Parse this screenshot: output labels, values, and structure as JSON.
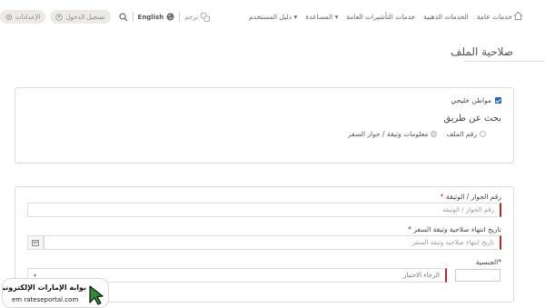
{
  "header": {
    "nav": [
      "خدمات عامة",
      "الخدمات الذهبية",
      "خدمات التأشيرات العامة",
      "المساعدة",
      "دليل المستخدم"
    ],
    "translate_label": "ترجم",
    "language_label": "English",
    "login_label": "تسجيل الدخول",
    "settings_label": "الإعدادات"
  },
  "page": {
    "title": "صلاحية الملف"
  },
  "search_panel": {
    "gcc_citizen_label": "مواطن خليجي",
    "gcc_citizen_checked": true,
    "search_by_label": "بحث عن طريق",
    "options": [
      "رقم الملف",
      "معلومات وثيقة / جواز السفر"
    ],
    "selected_option": "معلومات وثيقة / جواز السفر"
  },
  "form": {
    "passport_label": "رقم الجواز / الوثيقة",
    "passport_placeholder": "رقم الجواز / الوثيقة",
    "expiry_label": "تاريخ انتهاء صلاحية وثيقة السفر",
    "expiry_placeholder": "تاريخ انتهاء صلاحية وثيقة السفر",
    "nationality_label": "الجنسية",
    "nationality_value": "الرجاء الاختيار",
    "required_mark": "*"
  },
  "watermark": {
    "arabic": "بوابة الإمارات الإلكترونية",
    "english": "em rateseportal.com"
  },
  "colors": {
    "accent": "#b02a2a",
    "checkbox": "#2a66c8"
  }
}
